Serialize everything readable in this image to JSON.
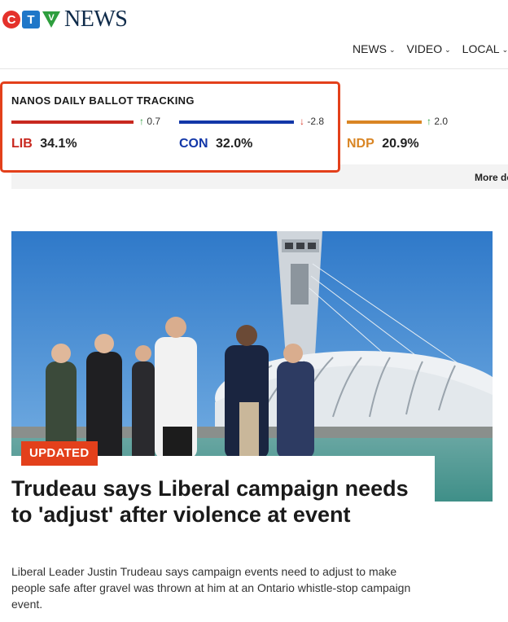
{
  "header": {
    "logo": {
      "letters": [
        "C",
        "T",
        "V"
      ],
      "word": "NEWS",
      "colors": {
        "c": "#e4312b",
        "t": "#1f77c8",
        "v": "#2e9e3e",
        "word": "#0f2b4a"
      }
    },
    "nav": {
      "items": [
        {
          "label": "NEWS",
          "icon": "chevron-down-icon"
        },
        {
          "label": "VIDEO",
          "icon": "chevron-down-icon"
        },
        {
          "label": "LOCAL",
          "icon": "chevron-down-icon"
        }
      ]
    }
  },
  "tracker": {
    "title": "NANOS DAILY BALLOT TRACKING",
    "border_color": "#e3401b",
    "more_link": "More details",
    "parties": [
      {
        "abbr": "LIB",
        "pct": "34.1%",
        "direction": "up",
        "arrow": "↑",
        "change": "0.7",
        "color": "#c8281f"
      },
      {
        "abbr": "CON",
        "pct": "32.0%",
        "direction": "down",
        "arrow": "↓",
        "change": "-2.8",
        "color": "#1237a8"
      },
      {
        "abbr": "NDP",
        "pct": "20.9%",
        "direction": "up",
        "arrow": "↑",
        "change": "2.0",
        "color": "#d98524"
      }
    ]
  },
  "story": {
    "badge": "UPDATED",
    "badge_color": "#e3401b",
    "headline": "Trudeau says Liberal campaign needs to 'adjust' after violence at event",
    "summary": "Liberal Leader Justin Trudeau says campaign events need to adjust to make people safe after gravel was thrown at him at an Ontario whistle-stop campaign event."
  }
}
